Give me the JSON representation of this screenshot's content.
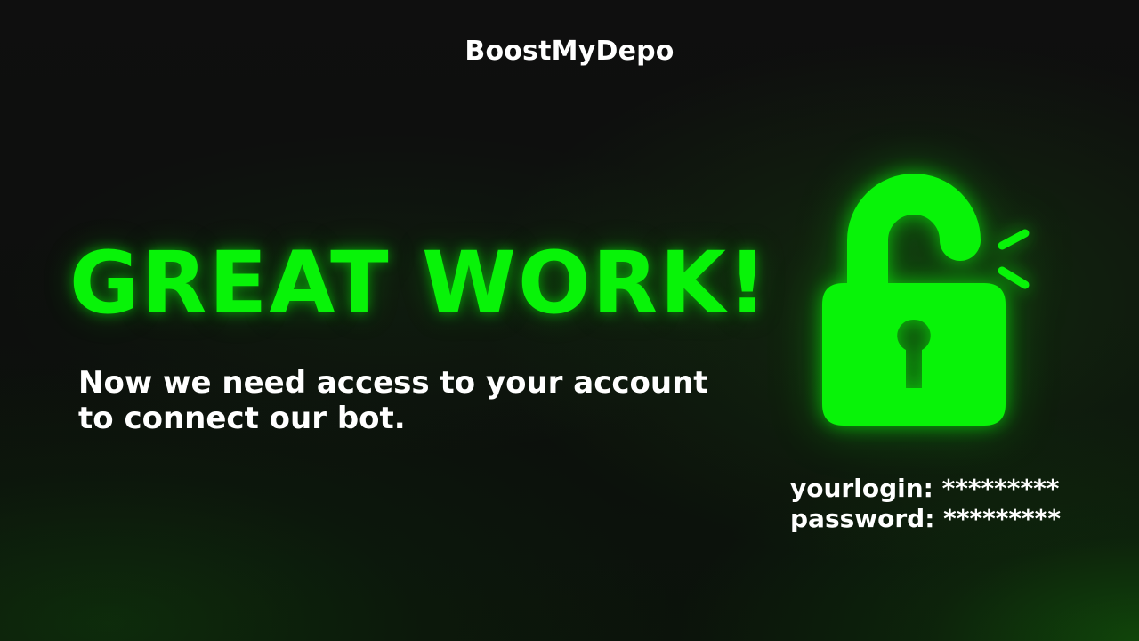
{
  "brand": {
    "name": "BoostMyDepo"
  },
  "hero": {
    "headline": "GREAT WORK!",
    "subtext_line1": "Now we need access to your account",
    "subtext_line2": "to connect our bot."
  },
  "lock": {
    "icon": "unlocked-padlock-icon",
    "color": "#08f308"
  },
  "credentials": {
    "login_label": "yourlogin:",
    "login_value": "*********",
    "password_label": "password:",
    "password_value": "*********"
  },
  "colors": {
    "accent": "#08f308",
    "background": "#0f0f0f",
    "text": "#ffffff"
  }
}
